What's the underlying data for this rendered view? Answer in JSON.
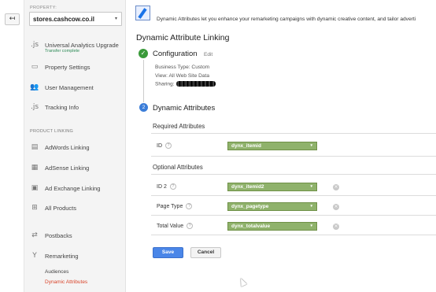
{
  "nav": {
    "back_icon": "back-arrow-icon",
    "back_glyph": "↤"
  },
  "property": {
    "label": "PROPERTY:",
    "selected": "stores.cashcow.co.il",
    "caret": "▾"
  },
  "sidebar": {
    "items": [
      {
        "label": "Universal Analytics Upgrade",
        "sub": "Transfer complete",
        "icon": "js-icon",
        "glyph": ".js"
      },
      {
        "label": "Property Settings",
        "icon": "settings-icon",
        "glyph": "▭"
      },
      {
        "label": "User Management",
        "icon": "users-icon",
        "glyph": "👥"
      },
      {
        "label": "Tracking Info",
        "icon": "js-icon",
        "glyph": ".js"
      }
    ],
    "product_linking_label": "PRODUCT LINKING",
    "links": [
      {
        "label": "AdWords Linking",
        "icon": "adwords-icon",
        "glyph": "▤"
      },
      {
        "label": "AdSense Linking",
        "icon": "adsense-icon",
        "glyph": "▦"
      },
      {
        "label": "Ad Exchange Linking",
        "icon": "adexchange-icon",
        "glyph": "▣"
      },
      {
        "label": "All Products",
        "icon": "products-icon",
        "glyph": "⊞"
      },
      {
        "label": "Postbacks",
        "icon": "postbacks-icon",
        "glyph": "⇄"
      },
      {
        "label": "Remarketing",
        "icon": "remarketing-icon",
        "glyph": "Y"
      }
    ],
    "remarketing_sub": [
      {
        "label": "Audiences"
      },
      {
        "label": "Dynamic Attributes"
      }
    ]
  },
  "banner": {
    "text": "Dynamic Attributes let you enhance your remarketing campaigns with dynamic creative content, and tailor adverti"
  },
  "page": {
    "title": "Dynamic Attribute Linking"
  },
  "configuration": {
    "check_glyph": "✓",
    "title": "Configuration",
    "edit": "Edit",
    "business_type": "Business Type: Custom",
    "view": "View: All Web Site Data",
    "sharing": "Sharing:"
  },
  "dynamic_attributes": {
    "step": "2",
    "title": "Dynamic Attributes",
    "required_title": "Required Attributes",
    "optional_title": "Optional Attributes",
    "help_glyph": "?",
    "caret": "▾",
    "remove_glyph": "×",
    "required": [
      {
        "label": "ID",
        "value": "dynx_itemid"
      }
    ],
    "optional": [
      {
        "label": "ID 2",
        "value": "dynx_itemid2"
      },
      {
        "label": "Page Type",
        "value": "dynx_pagetype"
      },
      {
        "label": "Total Value",
        "value": "dynx_totalvalue"
      }
    ]
  },
  "actions": {
    "save": "Save",
    "cancel": "Cancel"
  },
  "colors": {
    "accent": "#4a86e8",
    "attr_select": "#8fb26b",
    "active_nav": "#d9442a",
    "success": "#3a9a3a"
  }
}
